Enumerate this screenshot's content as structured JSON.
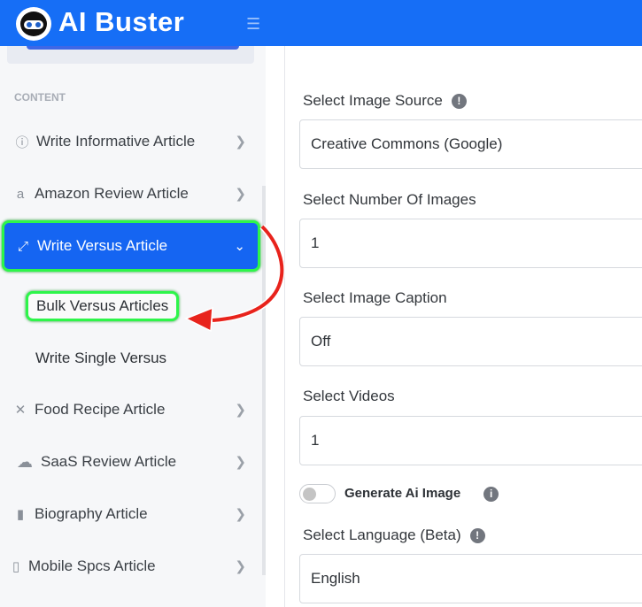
{
  "header": {
    "brand": "AI Buster",
    "menu_icon": "hamburger-icon"
  },
  "sidebar": {
    "section": "CONTENT",
    "items": [
      {
        "label": "Write Informative Article",
        "icon": "info-circle-icon"
      },
      {
        "label": "Amazon Review Article",
        "icon": "amazon-icon"
      },
      {
        "label": "Write Versus Article",
        "icon": "compress-arrows-icon",
        "active": true
      },
      {
        "label": "Food Recipe Article",
        "icon": "utensils-icon"
      },
      {
        "label": "SaaS Review Article",
        "icon": "cloud-icon"
      },
      {
        "label": "Biography Article",
        "icon": "book-icon"
      },
      {
        "label": "Mobile Spcs Article",
        "icon": "mobile-icon"
      }
    ],
    "subitems": [
      {
        "label": "Bulk Versus Articles",
        "highlighted": true
      },
      {
        "label": "Write Single Versus"
      }
    ]
  },
  "form": {
    "image_source": {
      "label": "Select Image Source",
      "value": "Creative Commons (Google)"
    },
    "num_images": {
      "label": "Select Number Of Images",
      "value": "1"
    },
    "caption": {
      "label": "Select Image Caption",
      "value": "Off"
    },
    "videos": {
      "label": "Select Videos",
      "value": "1"
    },
    "ai_image": {
      "label": "Generate Ai Image",
      "enabled": false
    },
    "language": {
      "label": "Select Language (Beta)",
      "value": "English"
    }
  },
  "colors": {
    "primary": "#166ef6",
    "highlight": "#2ef54a",
    "annotation_arrow": "#e8231c"
  }
}
